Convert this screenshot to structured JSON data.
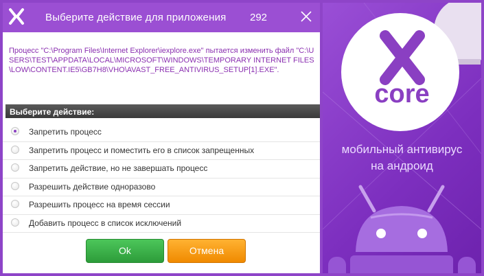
{
  "dialog": {
    "title": "Выберите действие для приложения",
    "count": "292",
    "message": "Процесс \"C:\\Program Files\\Internet Explorer\\iexplore.exe\" пытается изменить файл \"C:\\USERS\\TEST\\APPDATA\\LOCAL\\MICROSOFT\\WINDOWS\\TEMPORARY INTERNET FILES\\LOW\\CONTENT.IE5\\GB7H8\\VHO\\AVAST_FREE_ANTIVIRUS_SETUP[1].EXE\".",
    "section_label": "Выберите действие:",
    "options": [
      {
        "label": "Запретить процесс",
        "selected": true
      },
      {
        "label": "Запретить процесс и поместить его в список запрещенных",
        "selected": false
      },
      {
        "label": "Запретить действие, но не завершать процесс",
        "selected": false
      },
      {
        "label": "Разрешить действие одноразово",
        "selected": false
      },
      {
        "label": "Разрешить процесс на время сессии",
        "selected": false
      },
      {
        "label": "Добавить процесс в список исключений",
        "selected": false
      }
    ],
    "ok_label": "Ok",
    "cancel_label": "Отмена"
  },
  "ad": {
    "brand": "core",
    "tagline_line1": "мобильный антивирус",
    "tagline_line2": "на андроид"
  },
  "colors": {
    "accent": "#9b4fd3",
    "message_text": "#8a2fb0",
    "ok_green": "#2d9c3a",
    "cancel_orange": "#f08a00"
  },
  "icons": [
    "x-logo-icon",
    "close-icon",
    "android-robot-icon"
  ]
}
